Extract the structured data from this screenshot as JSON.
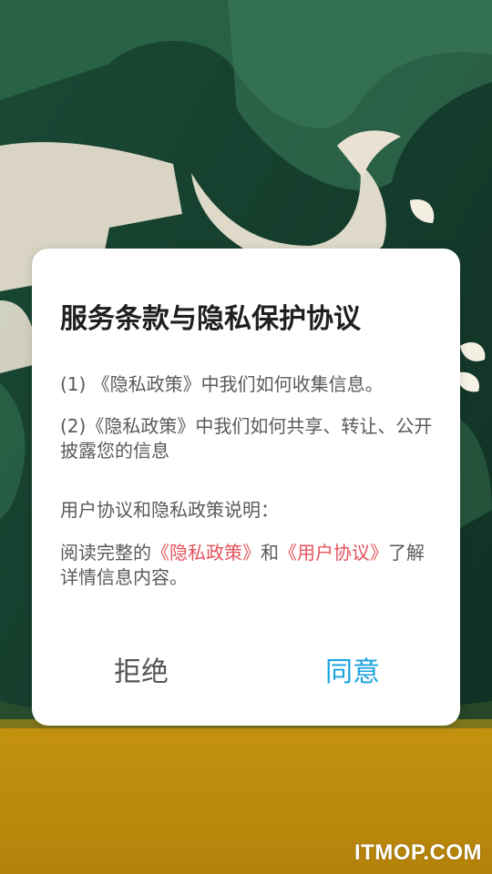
{
  "dialog": {
    "title": "服务条款与隐私保护协议",
    "item1": "(1) 《隐私政策》中我们如何收集信息。",
    "item2": "(2)《隐私政策》中我们如何共享、转让、公开披露您的信息",
    "note": "用户协议和隐私政策说明：",
    "read_prefix": "阅读完整的",
    "privacy_link": "《隐私政策》",
    "and_text": "和",
    "user_link": "《用户协议》",
    "read_suffix": "了解详情信息内容。",
    "reject_label": "拒绝",
    "agree_label": "同意"
  },
  "watermark": "ITMOP.COM",
  "colors": {
    "link": "#e5535d",
    "agree": "#1aa3e0",
    "background_green": "#1f4a35",
    "background_gold": "#c9960f"
  }
}
